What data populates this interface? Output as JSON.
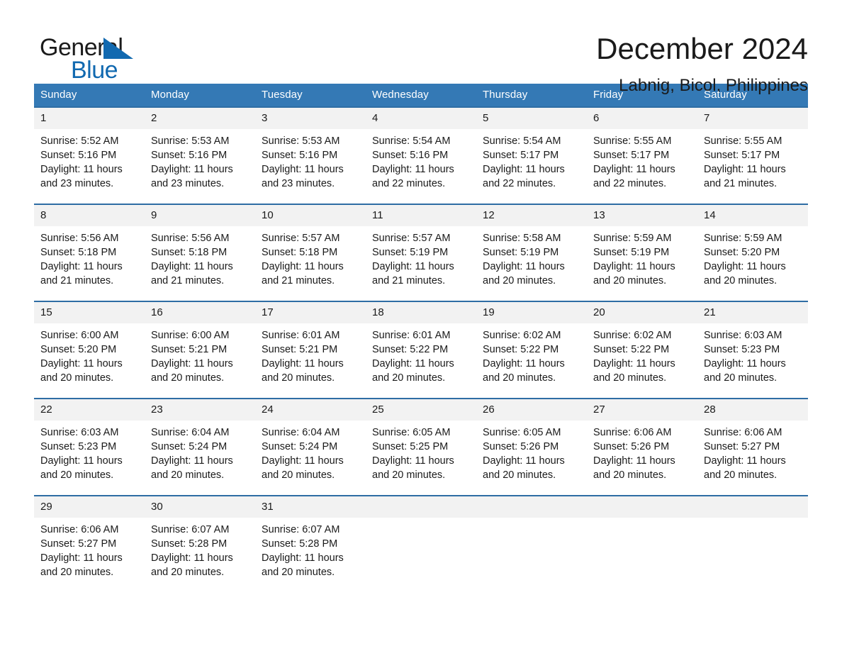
{
  "brand": {
    "word_one": "General",
    "word_two": "Blue",
    "triangle_color": "#1169b0",
    "text_color": "#1b1b1b"
  },
  "header": {
    "month_title": "December 2024",
    "location": "Labnig, Bicol, Philippines"
  },
  "calendar": {
    "header_bg": "#3479b5",
    "row_border": "#2e6da4",
    "daynum_bg": "#f2f2f2",
    "weekday_headers": [
      "Sunday",
      "Monday",
      "Tuesday",
      "Wednesday",
      "Thursday",
      "Friday",
      "Saturday"
    ],
    "weeks": [
      [
        {
          "day": "1",
          "sunrise": "Sunrise: 5:52 AM",
          "sunset": "Sunset: 5:16 PM",
          "daylight_line1": "Daylight: 11 hours",
          "daylight_line2": "and 23 minutes."
        },
        {
          "day": "2",
          "sunrise": "Sunrise: 5:53 AM",
          "sunset": "Sunset: 5:16 PM",
          "daylight_line1": "Daylight: 11 hours",
          "daylight_line2": "and 23 minutes."
        },
        {
          "day": "3",
          "sunrise": "Sunrise: 5:53 AM",
          "sunset": "Sunset: 5:16 PM",
          "daylight_line1": "Daylight: 11 hours",
          "daylight_line2": "and 23 minutes."
        },
        {
          "day": "4",
          "sunrise": "Sunrise: 5:54 AM",
          "sunset": "Sunset: 5:16 PM",
          "daylight_line1": "Daylight: 11 hours",
          "daylight_line2": "and 22 minutes."
        },
        {
          "day": "5",
          "sunrise": "Sunrise: 5:54 AM",
          "sunset": "Sunset: 5:17 PM",
          "daylight_line1": "Daylight: 11 hours",
          "daylight_line2": "and 22 minutes."
        },
        {
          "day": "6",
          "sunrise": "Sunrise: 5:55 AM",
          "sunset": "Sunset: 5:17 PM",
          "daylight_line1": "Daylight: 11 hours",
          "daylight_line2": "and 22 minutes."
        },
        {
          "day": "7",
          "sunrise": "Sunrise: 5:55 AM",
          "sunset": "Sunset: 5:17 PM",
          "daylight_line1": "Daylight: 11 hours",
          "daylight_line2": "and 21 minutes."
        }
      ],
      [
        {
          "day": "8",
          "sunrise": "Sunrise: 5:56 AM",
          "sunset": "Sunset: 5:18 PM",
          "daylight_line1": "Daylight: 11 hours",
          "daylight_line2": "and 21 minutes."
        },
        {
          "day": "9",
          "sunrise": "Sunrise: 5:56 AM",
          "sunset": "Sunset: 5:18 PM",
          "daylight_line1": "Daylight: 11 hours",
          "daylight_line2": "and 21 minutes."
        },
        {
          "day": "10",
          "sunrise": "Sunrise: 5:57 AM",
          "sunset": "Sunset: 5:18 PM",
          "daylight_line1": "Daylight: 11 hours",
          "daylight_line2": "and 21 minutes."
        },
        {
          "day": "11",
          "sunrise": "Sunrise: 5:57 AM",
          "sunset": "Sunset: 5:19 PM",
          "daylight_line1": "Daylight: 11 hours",
          "daylight_line2": "and 21 minutes."
        },
        {
          "day": "12",
          "sunrise": "Sunrise: 5:58 AM",
          "sunset": "Sunset: 5:19 PM",
          "daylight_line1": "Daylight: 11 hours",
          "daylight_line2": "and 20 minutes."
        },
        {
          "day": "13",
          "sunrise": "Sunrise: 5:59 AM",
          "sunset": "Sunset: 5:19 PM",
          "daylight_line1": "Daylight: 11 hours",
          "daylight_line2": "and 20 minutes."
        },
        {
          "day": "14",
          "sunrise": "Sunrise: 5:59 AM",
          "sunset": "Sunset: 5:20 PM",
          "daylight_line1": "Daylight: 11 hours",
          "daylight_line2": "and 20 minutes."
        }
      ],
      [
        {
          "day": "15",
          "sunrise": "Sunrise: 6:00 AM",
          "sunset": "Sunset: 5:20 PM",
          "daylight_line1": "Daylight: 11 hours",
          "daylight_line2": "and 20 minutes."
        },
        {
          "day": "16",
          "sunrise": "Sunrise: 6:00 AM",
          "sunset": "Sunset: 5:21 PM",
          "daylight_line1": "Daylight: 11 hours",
          "daylight_line2": "and 20 minutes."
        },
        {
          "day": "17",
          "sunrise": "Sunrise: 6:01 AM",
          "sunset": "Sunset: 5:21 PM",
          "daylight_line1": "Daylight: 11 hours",
          "daylight_line2": "and 20 minutes."
        },
        {
          "day": "18",
          "sunrise": "Sunrise: 6:01 AM",
          "sunset": "Sunset: 5:22 PM",
          "daylight_line1": "Daylight: 11 hours",
          "daylight_line2": "and 20 minutes."
        },
        {
          "day": "19",
          "sunrise": "Sunrise: 6:02 AM",
          "sunset": "Sunset: 5:22 PM",
          "daylight_line1": "Daylight: 11 hours",
          "daylight_line2": "and 20 minutes."
        },
        {
          "day": "20",
          "sunrise": "Sunrise: 6:02 AM",
          "sunset": "Sunset: 5:22 PM",
          "daylight_line1": "Daylight: 11 hours",
          "daylight_line2": "and 20 minutes."
        },
        {
          "day": "21",
          "sunrise": "Sunrise: 6:03 AM",
          "sunset": "Sunset: 5:23 PM",
          "daylight_line1": "Daylight: 11 hours",
          "daylight_line2": "and 20 minutes."
        }
      ],
      [
        {
          "day": "22",
          "sunrise": "Sunrise: 6:03 AM",
          "sunset": "Sunset: 5:23 PM",
          "daylight_line1": "Daylight: 11 hours",
          "daylight_line2": "and 20 minutes."
        },
        {
          "day": "23",
          "sunrise": "Sunrise: 6:04 AM",
          "sunset": "Sunset: 5:24 PM",
          "daylight_line1": "Daylight: 11 hours",
          "daylight_line2": "and 20 minutes."
        },
        {
          "day": "24",
          "sunrise": "Sunrise: 6:04 AM",
          "sunset": "Sunset: 5:24 PM",
          "daylight_line1": "Daylight: 11 hours",
          "daylight_line2": "and 20 minutes."
        },
        {
          "day": "25",
          "sunrise": "Sunrise: 6:05 AM",
          "sunset": "Sunset: 5:25 PM",
          "daylight_line1": "Daylight: 11 hours",
          "daylight_line2": "and 20 minutes."
        },
        {
          "day": "26",
          "sunrise": "Sunrise: 6:05 AM",
          "sunset": "Sunset: 5:26 PM",
          "daylight_line1": "Daylight: 11 hours",
          "daylight_line2": "and 20 minutes."
        },
        {
          "day": "27",
          "sunrise": "Sunrise: 6:06 AM",
          "sunset": "Sunset: 5:26 PM",
          "daylight_line1": "Daylight: 11 hours",
          "daylight_line2": "and 20 minutes."
        },
        {
          "day": "28",
          "sunrise": "Sunrise: 6:06 AM",
          "sunset": "Sunset: 5:27 PM",
          "daylight_line1": "Daylight: 11 hours",
          "daylight_line2": "and 20 minutes."
        }
      ],
      [
        {
          "day": "29",
          "sunrise": "Sunrise: 6:06 AM",
          "sunset": "Sunset: 5:27 PM",
          "daylight_line1": "Daylight: 11 hours",
          "daylight_line2": "and 20 minutes."
        },
        {
          "day": "30",
          "sunrise": "Sunrise: 6:07 AM",
          "sunset": "Sunset: 5:28 PM",
          "daylight_line1": "Daylight: 11 hours",
          "daylight_line2": "and 20 minutes."
        },
        {
          "day": "31",
          "sunrise": "Sunrise: 6:07 AM",
          "sunset": "Sunset: 5:28 PM",
          "daylight_line1": "Daylight: 11 hours",
          "daylight_line2": "and 20 minutes."
        },
        {
          "day": "",
          "sunrise": "",
          "sunset": "",
          "daylight_line1": "",
          "daylight_line2": ""
        },
        {
          "day": "",
          "sunrise": "",
          "sunset": "",
          "daylight_line1": "",
          "daylight_line2": ""
        },
        {
          "day": "",
          "sunrise": "",
          "sunset": "",
          "daylight_line1": "",
          "daylight_line2": ""
        },
        {
          "day": "",
          "sunrise": "",
          "sunset": "",
          "daylight_line1": "",
          "daylight_line2": ""
        }
      ]
    ]
  }
}
